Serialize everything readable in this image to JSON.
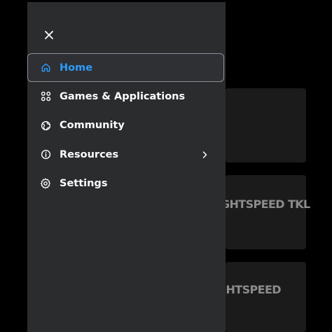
{
  "colors": {
    "drawer_bg": "#2b2c2e",
    "active_text": "#2d9cff",
    "text": "#ffffff"
  },
  "menu": {
    "close_icon": "close-icon",
    "items": [
      {
        "label": "Home",
        "icon": "home-icon",
        "active": true
      },
      {
        "label": "Games & Applications",
        "icon": "apps-grid-icon",
        "active": false
      },
      {
        "label": "Community",
        "icon": "globe-icon",
        "active": false
      },
      {
        "label": "Resources",
        "icon": "info-icon",
        "active": false,
        "has_submenu": true
      },
      {
        "label": "Settings",
        "icon": "gear-icon",
        "active": false
      }
    ]
  },
  "background": {
    "cards": [
      {
        "label": ""
      },
      {
        "label": "LIGHTSPEED TKL"
      },
      {
        "label": "LIGHTSPEED"
      }
    ]
  }
}
